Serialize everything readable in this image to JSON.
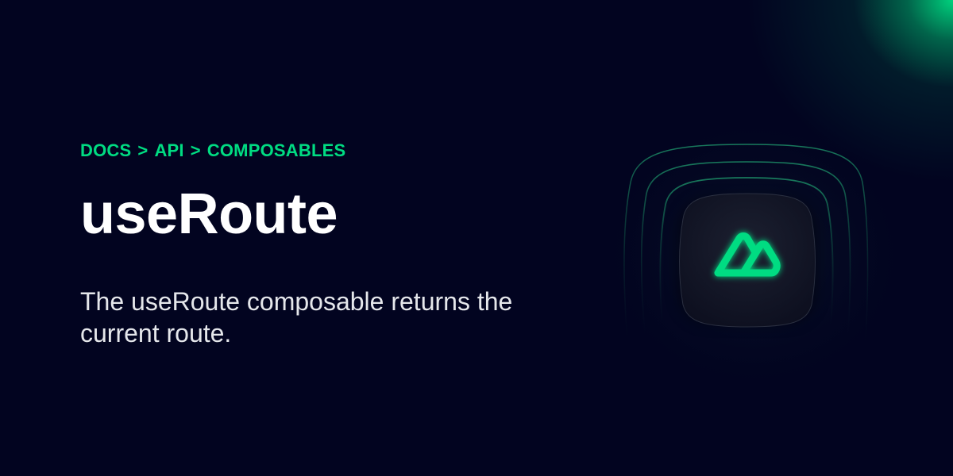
{
  "breadcrumb": {
    "items": [
      "DOCS",
      "API",
      "COMPOSABLES"
    ],
    "separator": ">"
  },
  "title": "useRoute",
  "description": "The useRoute composable returns the current route.",
  "colors": {
    "background": "#020420",
    "accent": "#00dc82",
    "title": "#ffffff",
    "description": "#e5e7eb"
  },
  "logo": {
    "icon": "nuxt-logo-icon"
  }
}
